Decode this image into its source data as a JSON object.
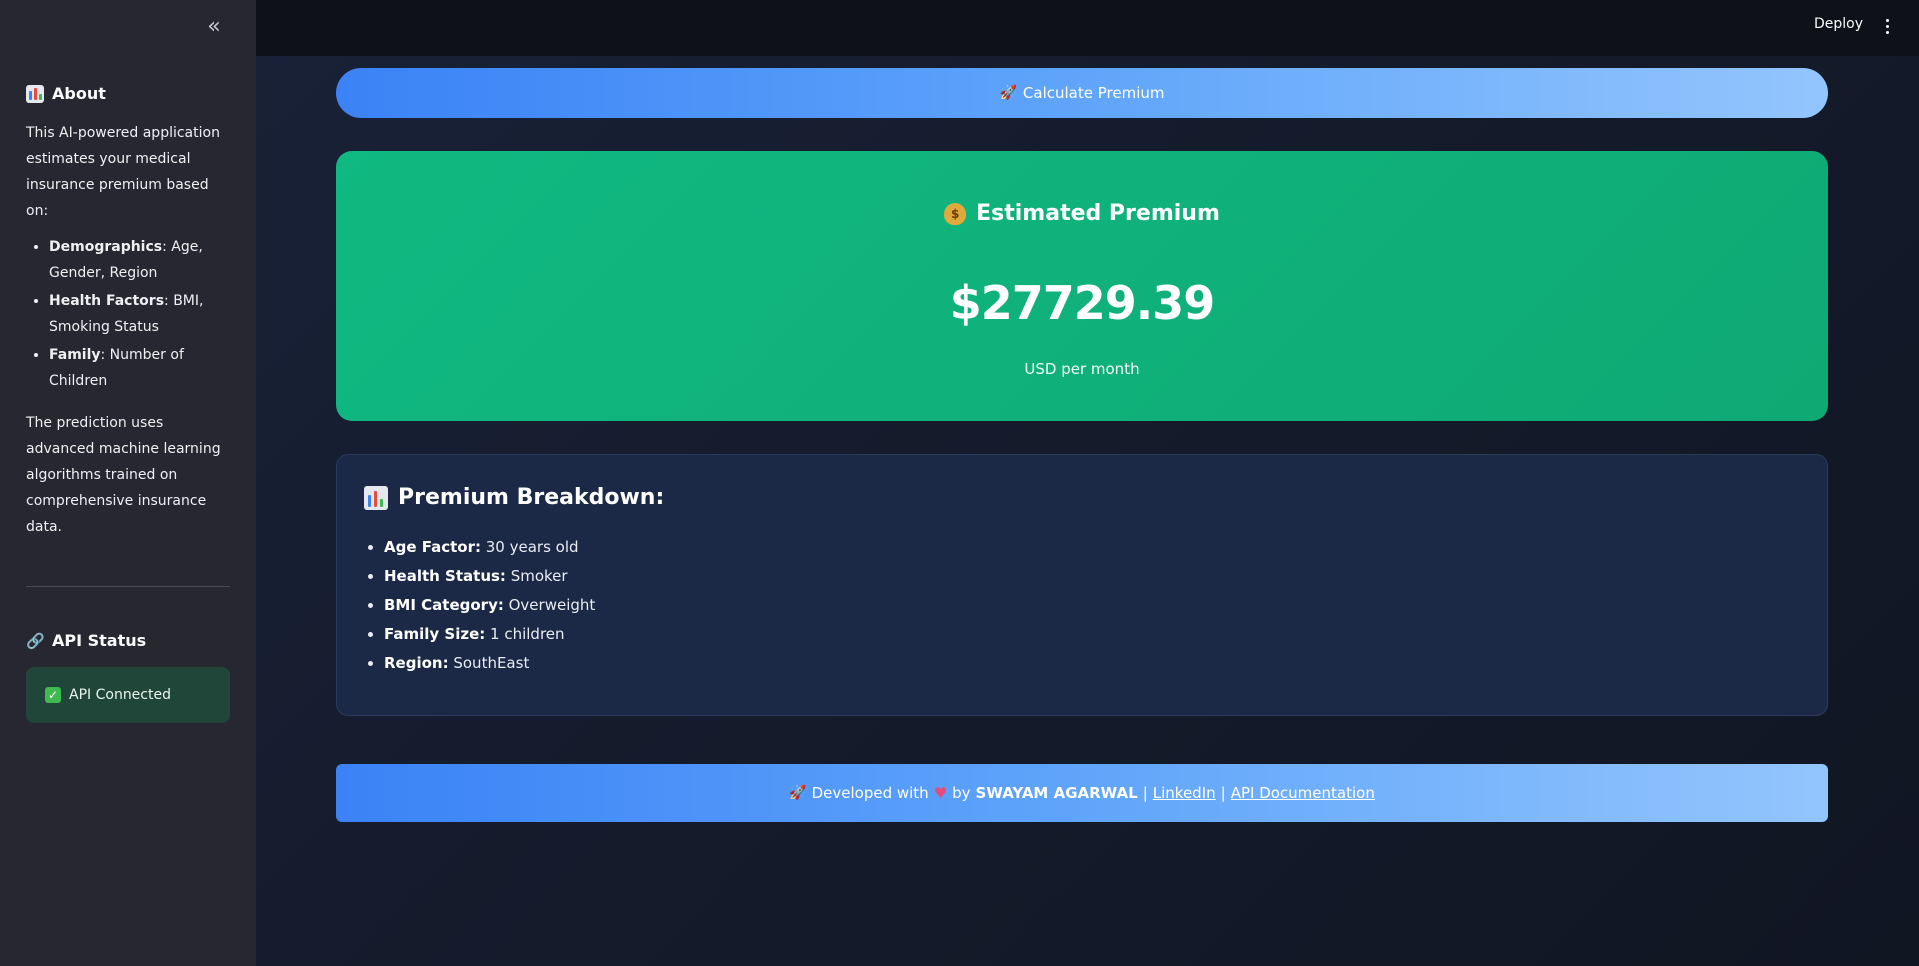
{
  "sidebar": {
    "collapse_icon": "«",
    "about": {
      "title": "About",
      "intro": "This AI-powered application estimates your medical insurance premium based on:",
      "factors": [
        {
          "label": "Demographics",
          "text": ": Age, Gender, Region"
        },
        {
          "label": "Health Factors",
          "text": ": BMI, Smoking Status"
        },
        {
          "label": "Family",
          "text": ": Number of Children"
        }
      ],
      "outro": "The prediction uses advanced machine learning algorithms trained on comprehensive insurance data."
    },
    "api": {
      "title": "API Status",
      "status": "API Connected"
    }
  },
  "topbar": {
    "deploy_label": "Deploy"
  },
  "main": {
    "calculate_label": "Calculate Premium",
    "premium": {
      "title": "Estimated Premium",
      "amount": "$27729.39",
      "unit": "USD per month"
    },
    "breakdown": {
      "title": "Premium Breakdown:",
      "items": [
        {
          "label": "Age Factor:",
          "value": " 30 years old"
        },
        {
          "label": "Health Status:",
          "value": " Smoker"
        },
        {
          "label": "BMI Category:",
          "value": " Overweight"
        },
        {
          "label": "Family Size:",
          "value": " 1 children"
        },
        {
          "label": "Region:",
          "value": " SouthEast"
        }
      ]
    },
    "footer": {
      "developed_with": "Developed with",
      "by": "by",
      "author": "SWAYAM AGARWAL",
      "sep1": "|",
      "linkedin": "LinkedIn",
      "sep2": "|",
      "api_docs": "API Documentation"
    }
  },
  "colors": {
    "sidebar_bg": "#262730",
    "premium_card": "#10b981",
    "button_gradient_start": "#3b82f6",
    "button_gradient_end": "#93c5fd",
    "status_bg": "#20463a"
  }
}
